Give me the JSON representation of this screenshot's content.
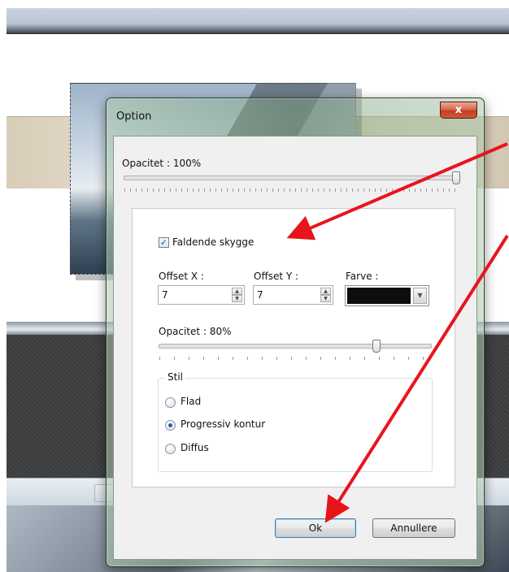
{
  "dialog": {
    "title": "Option",
    "close_glyph": "x",
    "opacity_label": "Opacitet : 100%",
    "opacity_value": 100,
    "shadow": {
      "checkbox_label": "Faldende skygge",
      "checked": true,
      "offset_x_label": "Offset X :",
      "offset_x_value": "7",
      "offset_y_label": "Offset Y :",
      "offset_y_value": "7",
      "color_label": "Farve :",
      "color_value": "#0d0d0d",
      "opacity_label": "Opacitet : 80%",
      "opacity_value": 80
    },
    "style_group": {
      "legend": "Stil",
      "options": [
        {
          "label": "Flad",
          "selected": false
        },
        {
          "label": "Progressiv kontur",
          "selected": true
        },
        {
          "label": "Diffus",
          "selected": false
        }
      ]
    },
    "ok_label": "Ok",
    "cancel_label": "Annullere"
  },
  "icons": {
    "close": "close-icon",
    "check": "checkmark-icon",
    "spin_up": "spin-up-icon",
    "spin_down": "spin-down-icon",
    "dropdown": "chevron-down-icon"
  },
  "colors": {
    "annotation_arrow": "#e8141c",
    "close_button": "#c23f1f",
    "default_button_border": "#3c7fb1"
  }
}
